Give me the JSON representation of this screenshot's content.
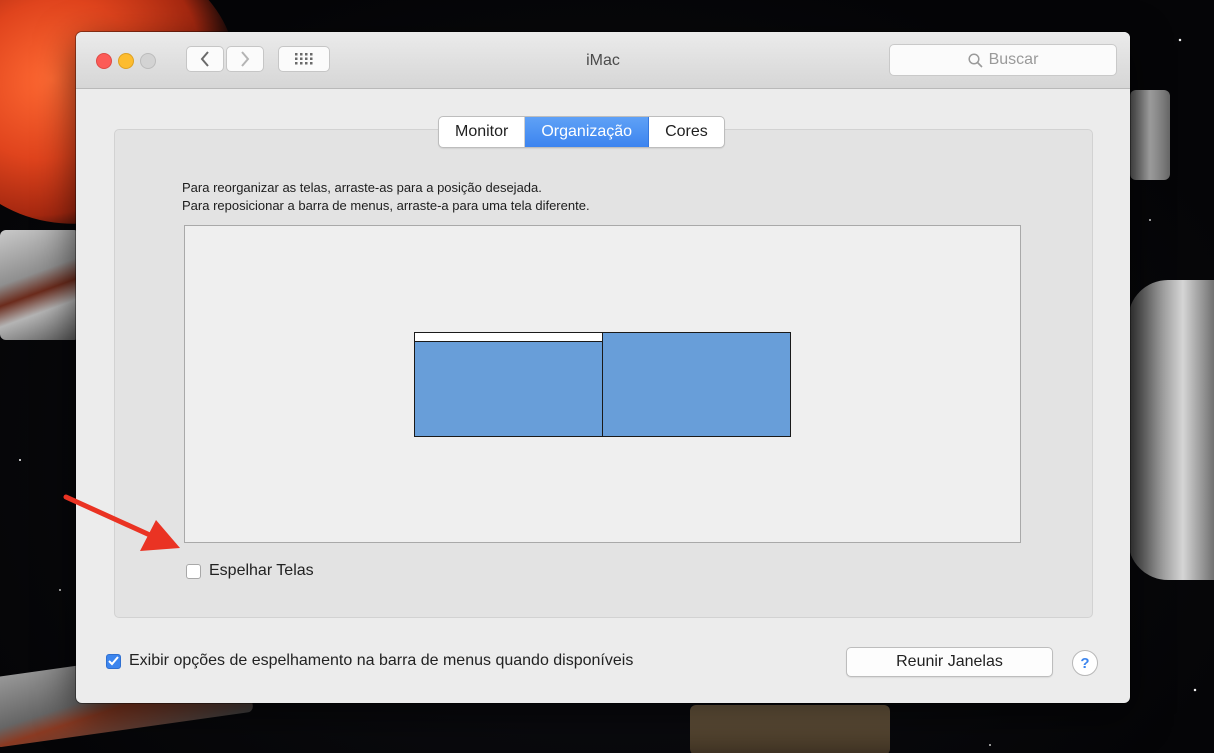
{
  "window": {
    "title": "iMac",
    "search_placeholder": "Buscar"
  },
  "tabs": [
    {
      "label": "Monitor",
      "active": false
    },
    {
      "label": "Organização",
      "active": true
    },
    {
      "label": "Cores",
      "active": false
    }
  ],
  "instructions": {
    "line1": "Para reorganizar as telas, arraste-as para a posição desejada.",
    "line2": "Para reposicionar a barra de menus, arraste-a para uma tela diferente."
  },
  "mirror_displays": {
    "label": "Espelhar Telas",
    "checked": false
  },
  "show_mirroring_options": {
    "label": "Exibir opções de espelhamento na barra de menus quando disponíveis",
    "checked": true
  },
  "gather_windows_button": "Reunir Janelas",
  "help_button": "?",
  "colors": {
    "accent": "#3c85ee",
    "display_fill": "#689ed9",
    "annotation_arrow": "#ea3323"
  }
}
